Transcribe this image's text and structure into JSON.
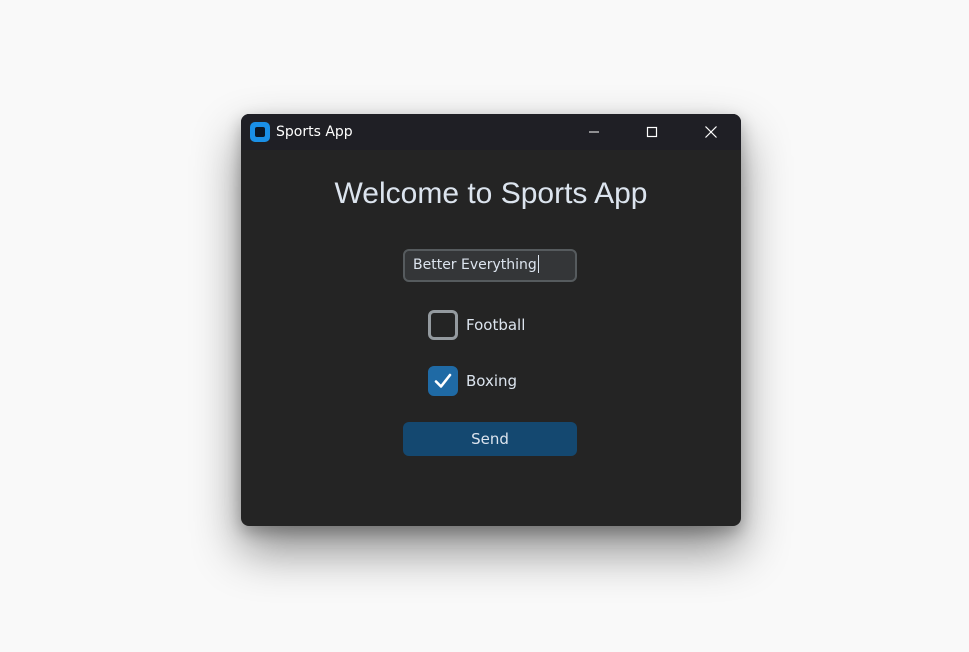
{
  "window": {
    "title": "Sports App",
    "icon": "app-icon",
    "controls": [
      "minimize-icon",
      "maximize-icon",
      "close-icon"
    ]
  },
  "main": {
    "heading": "Welcome to Sports App",
    "entry": {
      "value": "Better Everything"
    },
    "checkboxes": [
      {
        "label": "Football",
        "checked": false
      },
      {
        "label": "Boxing",
        "checked": true
      }
    ],
    "send_label": "Send"
  },
  "colors": {
    "accent": "#1f6aa5",
    "button": "#144870",
    "background": "#242424",
    "titlebar": "#1f1f25",
    "text": "#dce4ee"
  }
}
